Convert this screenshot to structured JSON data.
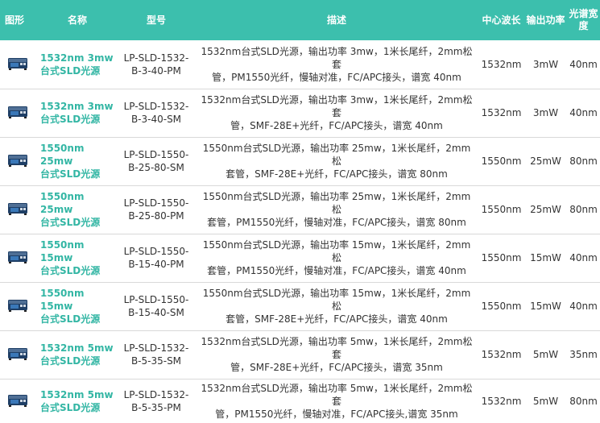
{
  "header": {
    "image": "图形",
    "name": "名称",
    "model": "型号",
    "desc": "描述",
    "wavelength": "中心波长",
    "power": "输出功率",
    "width": "光谱宽度"
  },
  "rows": [
    {
      "name_line1": "1532nm 3mw",
      "name_line2": "台式SLD光源",
      "model_line1": "LP-SLD-1532-",
      "model_line2": "B-3-40-PM",
      "desc_line1": "1532nm台式SLD光源，输出功率 3mw，1米长尾纤，2mm松套",
      "desc_line2": "管，PM1550光纤，慢轴对准，FC/APC接头，谱宽 40nm",
      "wavelength": "1532nm",
      "power": "3mW",
      "width": "40nm"
    },
    {
      "name_line1": "1532nm 3mw",
      "name_line2": "台式SLD光源",
      "model_line1": "LP-SLD-1532-",
      "model_line2": "B-3-40-SM",
      "desc_line1": "1532nm台式SLD光源，输出功率 3mw，1米长尾纤，2mm松套",
      "desc_line2": "管，SMF-28E+光纤，FC/APC接头，谱宽 40nm",
      "wavelength": "1532nm",
      "power": "3mW",
      "width": "40nm"
    },
    {
      "name_line1": "1550nm 25mw",
      "name_line2": "台式SLD光源",
      "model_line1": "LP-SLD-1550-",
      "model_line2": "B-25-80-SM",
      "desc_line1": "1550nm台式SLD光源，输出功率 25mw，1米长尾纤，2mm松",
      "desc_line2": "套管，SMF-28E+光纤，FC/APC接头，谱宽 80nm",
      "wavelength": "1550nm",
      "power": "25mW",
      "width": "80nm"
    },
    {
      "name_line1": "1550nm 25mw",
      "name_line2": "台式SLD光源",
      "model_line1": "LP-SLD-1550-",
      "model_line2": "B-25-80-PM",
      "desc_line1": "1550nm台式SLD光源，输出功率 25mw，1米长尾纤，2mm松",
      "desc_line2": "套管，PM1550光纤，慢轴对准，FC/APC接头，谱宽 80nm",
      "wavelength": "1550nm",
      "power": "25mW",
      "width": "80nm"
    },
    {
      "name_line1": "1550nm 15mw",
      "name_line2": "台式SLD光源",
      "model_line1": "LP-SLD-1550-",
      "model_line2": "B-15-40-PM",
      "desc_line1": "1550nm台式SLD光源，输出功率 15mw，1米长尾纤，2mm松",
      "desc_line2": "套管，PM1550光纤，慢轴对准，FC/APC接头，谱宽 40nm",
      "wavelength": "1550nm",
      "power": "15mW",
      "width": "40nm"
    },
    {
      "name_line1": "1550nm 15mw",
      "name_line2": "台式SLD光源",
      "model_line1": "LP-SLD-1550-",
      "model_line2": "B-15-40-SM",
      "desc_line1": "1550nm台式SLD光源，输出功率 15mw，1米长尾纤，2mm松",
      "desc_line2": "套管，SMF-28E+光纤，FC/APC接头，谱宽 40nm",
      "wavelength": "1550nm",
      "power": "15mW",
      "width": "40nm"
    },
    {
      "name_line1": "1532nm 5mw",
      "name_line2": "台式SLD光源",
      "model_line1": "LP-SLD-1532-",
      "model_line2": "B-5-35-SM",
      "desc_line1": "1532nm台式SLD光源，输出功率 5mw，1米长尾纤，2mm松套",
      "desc_line2": "管，SMF-28E+光纤，FC/APC接头，谱宽 35nm",
      "wavelength": "1532nm",
      "power": "5mW",
      "width": "35nm"
    },
    {
      "name_line1": "1532nm 5mw",
      "name_line2": "台式SLD光源",
      "model_line1": "LP-SLD-1532-",
      "model_line2": "B-5-35-PM",
      "desc_line1": "1532nm台式SLD光源，输出功率 5mw，1米长尾纤，2mm松套",
      "desc_line2": "管，PM1550光纤，慢轴对准，FC/APC接头,谱宽 35nm",
      "wavelength": "1532nm",
      "power": "5mW",
      "width": "80nm"
    }
  ],
  "icon": "desktop-sld-device-icon",
  "colors": {
    "header_bg": "#3cbfad",
    "name_text": "#33b6a4",
    "device_body": "#1f3f66",
    "device_panel": "#3a78b8"
  }
}
